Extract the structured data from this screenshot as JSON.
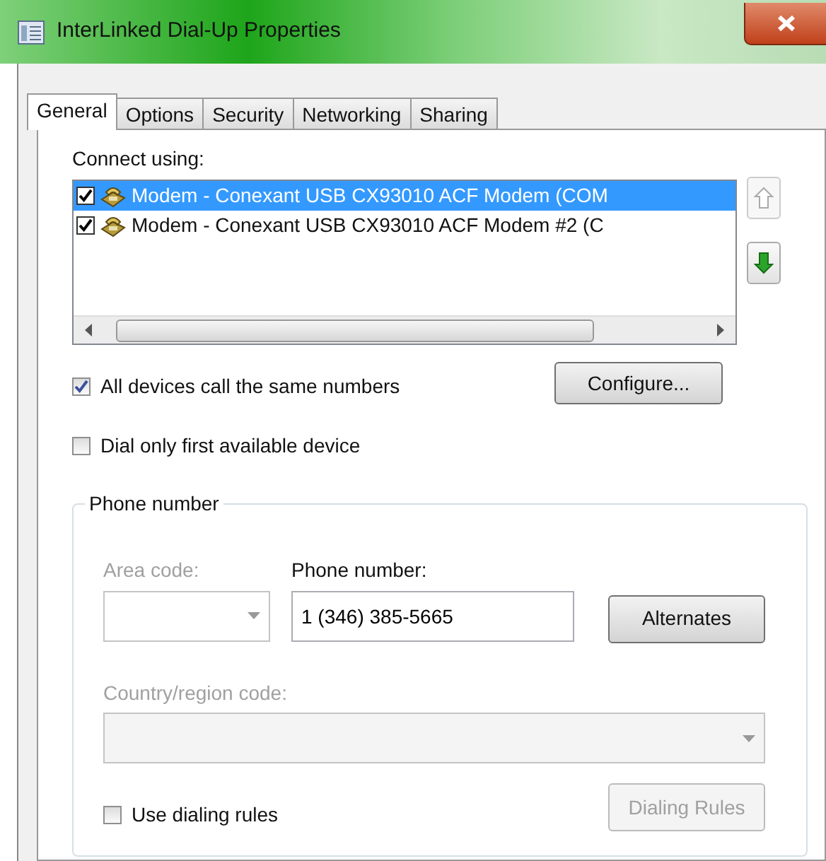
{
  "window": {
    "title": "InterLinked Dial-Up Properties"
  },
  "tabs": [
    {
      "label": "General",
      "selected": true
    },
    {
      "label": "Options",
      "selected": false
    },
    {
      "label": "Security",
      "selected": false
    },
    {
      "label": "Networking",
      "selected": false
    },
    {
      "label": "Sharing",
      "selected": false
    }
  ],
  "connect_using": {
    "label": "Connect using:",
    "devices": [
      {
        "label": "Modem - Conexant USB CX93010 ACF Modem (COM",
        "checked": true,
        "selected": true
      },
      {
        "label": "Modem - Conexant USB CX93010 ACF Modem #2 (C",
        "checked": true,
        "selected": false
      }
    ],
    "move_buttons": [
      {
        "kind": "up",
        "disabled": true
      },
      {
        "kind": "down",
        "disabled": false
      }
    ]
  },
  "options": [
    {
      "label": "All devices call the same numbers",
      "checked": true
    },
    {
      "label": "Dial only first available device",
      "checked": false
    }
  ],
  "configure_button": "Configure...",
  "phone_group": {
    "title": "Phone number",
    "area_code": {
      "label": "Area code:",
      "disabled": true
    },
    "phone_number": {
      "label": "Phone number:",
      "value": "1 (346) 385-5665"
    },
    "alternates_button": "Alternates",
    "country": {
      "label": "Country/region code:",
      "disabled": true
    },
    "use_dialing_rules": {
      "label": "Use dialing rules",
      "checked": false
    },
    "dialing_rules_button": {
      "label": "Dialing Rules",
      "disabled": true
    }
  }
}
